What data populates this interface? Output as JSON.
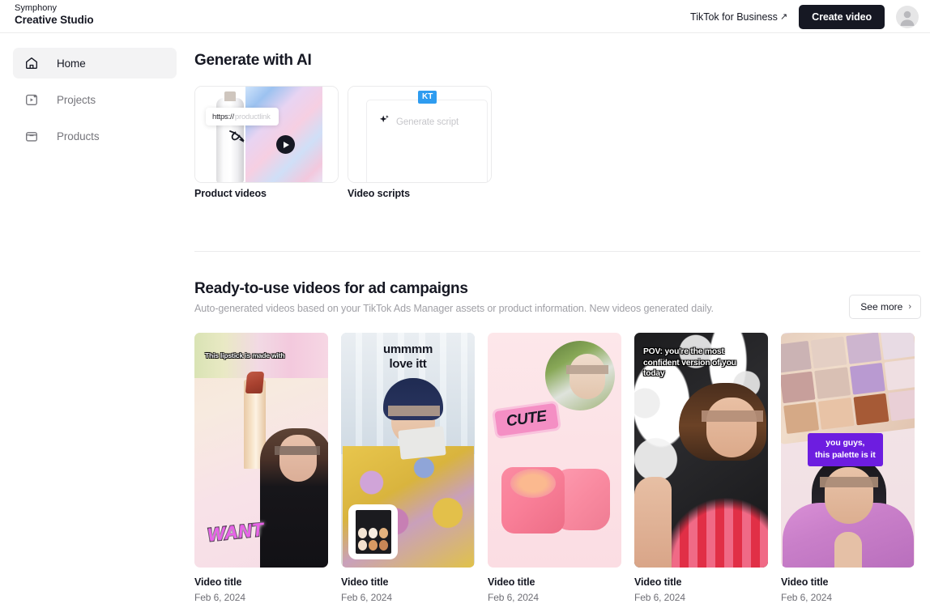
{
  "header": {
    "brand_top": "Symphony",
    "brand_bottom": "Creative Studio",
    "tiktok_for_business": "TikTok for Business",
    "external_link_arrow": "↗",
    "create_video": "Create video",
    "avatar_icon": "user-avatar-icon"
  },
  "sidebar": {
    "items": [
      {
        "label": "Home",
        "icon": "home-icon",
        "active": true
      },
      {
        "label": "Projects",
        "icon": "projects-play-icon",
        "active": false
      },
      {
        "label": "Products",
        "icon": "products-bag-icon",
        "active": false
      }
    ]
  },
  "generate": {
    "title": "Generate with AI",
    "cards": [
      {
        "caption": "Product videos",
        "url_scheme": "https://",
        "url_rest": "productlink",
        "play_icon": "play-icon",
        "cursor_icon": "cursor-arrow-icon"
      },
      {
        "caption": "Video scripts",
        "placeholder": "Generate script",
        "sparkle_icon": "sparkle-icon",
        "collaborator_badge": "KT",
        "collaborator_badge_color": "#2e9cf0"
      }
    ]
  },
  "ready": {
    "title": "Ready-to-use videos for ad campaigns",
    "subtitle": "Auto-generated videos based on your TikTok Ads Manager assets or product information. New videos generated daily.",
    "see_more": "See more",
    "see_more_chevron": "›",
    "videos": [
      {
        "title": "Video title",
        "date": "Feb 6, 2024",
        "overlay_caption": "This lipstick is made with",
        "sticker": "WANT",
        "theme": "lipstick-gradient"
      },
      {
        "title": "Video title",
        "date": "Feb 6, 2024",
        "overlay_caption": "ummmm\nlove itt",
        "sticker": "",
        "theme": "creator-palette-inset"
      },
      {
        "title": "Video title",
        "date": "Feb 6, 2024",
        "overlay_caption": "",
        "sticker": "CUTE",
        "theme": "pink-lip-balm"
      },
      {
        "title": "Video title",
        "date": "Feb 6, 2024",
        "overlay_caption": "POV: you're the most confident version of you today",
        "sticker": "",
        "theme": "graffiti-confidence"
      },
      {
        "title": "Video title",
        "date": "Feb 6, 2024",
        "overlay_caption": "you guys,\nthis palette is it",
        "sticker": "",
        "theme": "eyeshadow-palette"
      }
    ]
  },
  "colors": {
    "accent_dark": "#161823",
    "badge_blue": "#2e9cf0",
    "caption_purple": "#6d1de0",
    "sticker_pink": "#f48fc4",
    "page_background": "#ffffff",
    "nav_active_background": "#f3f3f4"
  }
}
